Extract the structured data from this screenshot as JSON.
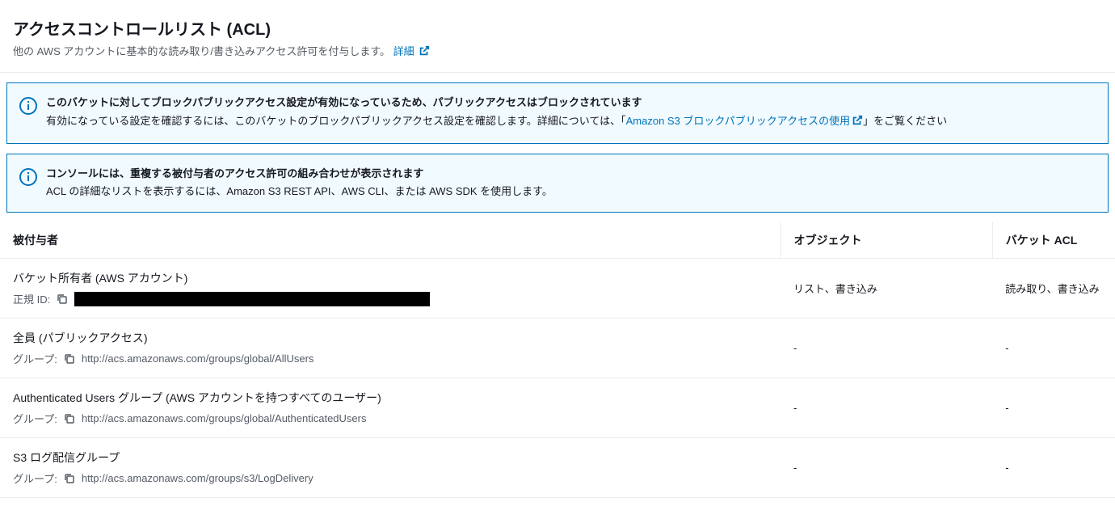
{
  "header": {
    "title": "アクセスコントロールリスト (ACL)",
    "subtitle": "他の AWS アカウントに基本的な読み取り/書き込みアクセス許可を付与します。",
    "details_link": "詳細"
  },
  "alerts": [
    {
      "title": "このバケットに対してブロックパブリックアクセス設定が有効になっているため、パブリックアクセスはブロックされています",
      "desc_pre": "有効になっている設定を確認するには、このバケットのブロックパブリックアクセス設定を確認します。詳細については、「",
      "link": "Amazon S3 ブロックパブリックアクセスの使用",
      "desc_post": "」をご覧ください"
    },
    {
      "title": "コンソールには、重複する被付与者のアクセス許可の組み合わせが表示されます",
      "desc": "ACL の詳細なリストを表示するには、Amazon S3 REST API、AWS CLI、または AWS SDK を使用します。"
    }
  ],
  "table": {
    "headers": {
      "grantee": "被付与者",
      "objects": "オブジェクト",
      "bucket_acl": "バケット ACL"
    },
    "labels": {
      "canonical_id": "正規 ID:",
      "group": "グループ:"
    },
    "rows": [
      {
        "name": "バケット所有者 (AWS アカウント)",
        "sub_type": "id",
        "sub_value": "",
        "objects": "リスト、書き込み",
        "acl": "読み取り、書き込み"
      },
      {
        "name": "全員 (パブリックアクセス)",
        "sub_type": "group",
        "sub_value": "http://acs.amazonaws.com/groups/global/AllUsers",
        "objects": "-",
        "acl": "-"
      },
      {
        "name": "Authenticated Users グループ (AWS アカウントを持つすべてのユーザー)",
        "sub_type": "group",
        "sub_value": "http://acs.amazonaws.com/groups/global/AuthenticatedUsers",
        "objects": "-",
        "acl": "-"
      },
      {
        "name": "S3 ログ配信グループ",
        "sub_type": "group",
        "sub_value": "http://acs.amazonaws.com/groups/s3/LogDelivery",
        "objects": "-",
        "acl": "-"
      }
    ]
  }
}
